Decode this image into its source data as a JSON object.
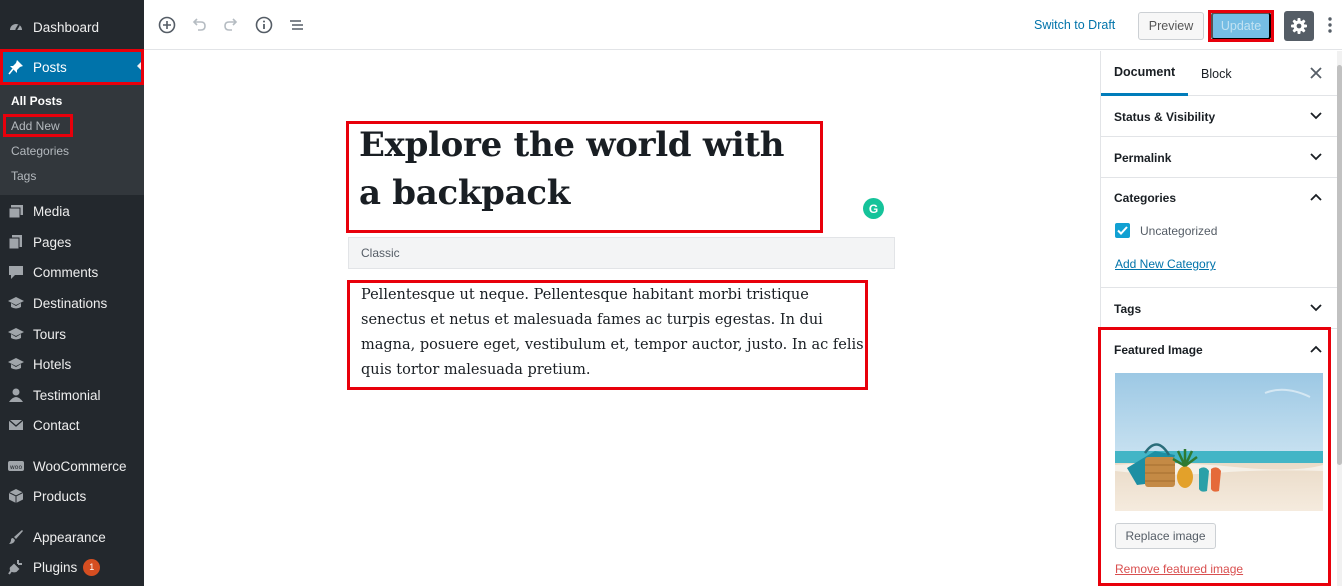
{
  "sidebar": {
    "items": [
      {
        "label": "Dashboard",
        "icon": "dashboard-icon"
      },
      {
        "label": "Posts",
        "icon": "pin-icon"
      },
      {
        "label": "Media",
        "icon": "media-icon"
      },
      {
        "label": "Pages",
        "icon": "pages-icon"
      },
      {
        "label": "Comments",
        "icon": "comments-icon"
      },
      {
        "label": "Destinations",
        "icon": "graduation-cap-icon"
      },
      {
        "label": "Tours",
        "icon": "graduation-cap-icon"
      },
      {
        "label": "Hotels",
        "icon": "graduation-cap-icon"
      },
      {
        "label": "Testimonial",
        "icon": "person-icon"
      },
      {
        "label": "Contact",
        "icon": "envelope-icon"
      },
      {
        "label": "WooCommerce",
        "icon": "woo-icon"
      },
      {
        "label": "Products",
        "icon": "box-icon"
      },
      {
        "label": "Appearance",
        "icon": "paintbrush-icon"
      },
      {
        "label": "Plugins",
        "icon": "plug-icon",
        "badge": "1"
      }
    ],
    "submenu": [
      "All Posts",
      "Add New",
      "Categories",
      "Tags"
    ]
  },
  "toolbar": {
    "switch_to_draft": "Switch to Draft",
    "preview": "Preview",
    "update": "Update"
  },
  "editor": {
    "title": "Explore the world with a backpack",
    "block_label": "Classic",
    "body": "Pellentesque ut neque. Pellentesque habitant morbi tristique senectus et netus et malesuada fames ac turpis egestas. In dui magna, posuere eget, vestibulum et, tempor auctor, justo. In ac felis quis tortor malesuada pretium.",
    "grammarly": "G"
  },
  "panel": {
    "tabs": [
      "Document",
      "Block"
    ],
    "sections": {
      "status": "Status & Visibility",
      "permalink": "Permalink",
      "categories": "Categories",
      "tags": "Tags",
      "featured_image": "Featured Image"
    },
    "category_option": "Uncategorized",
    "add_category": "Add New Category",
    "replace_image": "Replace image",
    "remove_image": "Remove featured image"
  },
  "colors": {
    "sidebar_bg": "#23282d",
    "active_blue": "#0073aa",
    "annotation_red": "#e8000b"
  }
}
